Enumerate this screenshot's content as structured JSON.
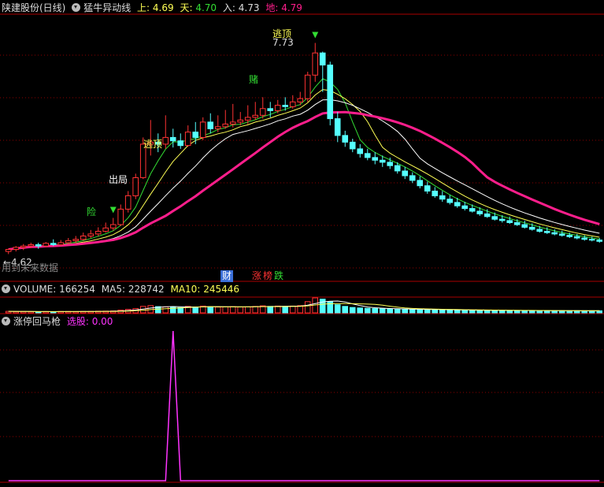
{
  "header": {
    "stock_title": "陕建股份(日线)",
    "indicator_name": "猛牛异动线",
    "shang_label": "上:",
    "shang_value": "4.69",
    "tian_label": "天:",
    "tian_value": "4.70",
    "ru_label": "入:",
    "ru_value": "4.73",
    "di_label": "地:",
    "di_value": "4.79"
  },
  "price_panel": {
    "low_marker": "←4.62",
    "watermark": "用到未来数据",
    "peak_label": "逃顶",
    "peak_value": "7.73",
    "signals": [
      {
        "text": "险",
        "color": "#33dd33"
      },
      {
        "text": "出局",
        "color": "#ffffff"
      },
      {
        "text": "逃顶",
        "color": "#ffff55"
      },
      {
        "text": "赌",
        "color": "#33dd33"
      }
    ],
    "bottom_tags": [
      {
        "text": "财",
        "bg": "#3a6fd8",
        "color": "#ffffff"
      },
      {
        "text": "涨",
        "bg": "#000000",
        "color": "#ff3333"
      },
      {
        "text": "榜",
        "bg": "#000000",
        "color": "#ff3333"
      },
      {
        "text": "跌",
        "bg": "#000000",
        "color": "#33dd33"
      }
    ]
  },
  "volume_header": {
    "volume_label": "VOLUME:",
    "volume_value": "166254",
    "ma5_label": "MA5:",
    "ma5_value": "228742",
    "ma10_label": "MA10:",
    "ma10_value": "245446"
  },
  "indicator_header": {
    "name": "涨停回马枪",
    "pick_label": "选股:",
    "pick_value": "0.00"
  },
  "colors": {
    "up": "#ff3333",
    "down": "#55ffff",
    "ma_short": "#ffffff",
    "ma_mid": "#ffff55",
    "ma_long": "#33dd33",
    "ma_trend": "#ff1e8c",
    "indicator_line": "#ff33ff",
    "grid": "#8b0000"
  },
  "chart_data": {
    "type": "candlestick",
    "price_range": [
      4.55,
      7.9
    ],
    "candles": [
      [
        4.62,
        4.65,
        4.58,
        4.66
      ],
      [
        4.65,
        4.68,
        4.62,
        4.7
      ],
      [
        4.68,
        4.7,
        4.64,
        4.73
      ],
      [
        4.7,
        4.72,
        4.67,
        4.75
      ],
      [
        4.72,
        4.7,
        4.66,
        4.75
      ],
      [
        4.7,
        4.74,
        4.68,
        4.76
      ],
      [
        4.74,
        4.72,
        4.7,
        4.8
      ],
      [
        4.72,
        4.75,
        4.7,
        4.79
      ],
      [
        4.75,
        4.78,
        4.73,
        4.82
      ],
      [
        4.78,
        4.8,
        4.75,
        4.85
      ],
      [
        4.8,
        4.85,
        4.78,
        4.9
      ],
      [
        4.85,
        4.88,
        4.82,
        4.94
      ],
      [
        4.88,
        4.92,
        4.85,
        4.98
      ],
      [
        4.92,
        4.97,
        4.9,
        5.05
      ],
      [
        4.97,
        5.02,
        4.93,
        5.12
      ],
      [
        5.02,
        5.25,
        5.0,
        5.32
      ],
      [
        5.25,
        5.45,
        5.2,
        5.52
      ],
      [
        5.45,
        5.72,
        5.4,
        5.78
      ],
      [
        5.72,
        6.22,
        5.7,
        6.32
      ],
      [
        6.22,
        6.25,
        6.05,
        6.58
      ],
      [
        6.25,
        6.22,
        6.1,
        6.38
      ],
      [
        6.22,
        6.32,
        6.15,
        6.65
      ],
      [
        6.32,
        6.27,
        6.17,
        6.45
      ],
      [
        6.27,
        6.2,
        6.15,
        6.38
      ],
      [
        6.2,
        6.4,
        6.18,
        6.5
      ],
      [
        6.4,
        6.32,
        6.22,
        6.55
      ],
      [
        6.32,
        6.55,
        6.28,
        6.62
      ],
      [
        6.55,
        6.45,
        6.38,
        6.68
      ],
      [
        6.45,
        6.48,
        6.4,
        6.65
      ],
      [
        6.48,
        6.52,
        6.45,
        6.73
      ],
      [
        6.52,
        6.55,
        6.47,
        6.82
      ],
      [
        6.55,
        6.58,
        6.5,
        6.7
      ],
      [
        6.58,
        6.62,
        6.52,
        6.8
      ],
      [
        6.62,
        6.65,
        6.58,
        6.85
      ],
      [
        6.65,
        6.75,
        6.6,
        6.92
      ],
      [
        6.75,
        6.72,
        6.62,
        6.85
      ],
      [
        6.72,
        6.8,
        6.68,
        6.88
      ],
      [
        6.8,
        6.78,
        6.72,
        6.92
      ],
      [
        6.78,
        6.85,
        6.75,
        6.95
      ],
      [
        6.85,
        6.9,
        6.8,
        7.0
      ],
      [
        6.9,
        7.25,
        6.85,
        7.3
      ],
      [
        7.25,
        7.58,
        7.15,
        7.73
      ],
      [
        7.58,
        7.4,
        7.0,
        7.6
      ],
      [
        7.4,
        6.6,
        6.5,
        7.45
      ],
      [
        6.6,
        6.35,
        6.25,
        6.7
      ],
      [
        6.35,
        6.25,
        6.18,
        6.42
      ],
      [
        6.25,
        6.15,
        6.1,
        6.3
      ],
      [
        6.15,
        6.08,
        6.02,
        6.22
      ],
      [
        6.08,
        6.02,
        5.98,
        6.15
      ],
      [
        6.02,
        5.98,
        5.92,
        6.1
      ],
      [
        5.98,
        5.95,
        5.88,
        6.05
      ],
      [
        5.95,
        5.9,
        5.85,
        6.02
      ],
      [
        5.9,
        5.82,
        5.78,
        5.95
      ],
      [
        5.82,
        5.75,
        5.7,
        5.88
      ],
      [
        5.75,
        5.68,
        5.64,
        5.8
      ],
      [
        5.68,
        5.6,
        5.56,
        5.74
      ],
      [
        5.6,
        5.52,
        5.48,
        5.66
      ],
      [
        5.52,
        5.45,
        5.42,
        5.58
      ],
      [
        5.45,
        5.4,
        5.36,
        5.52
      ],
      [
        5.4,
        5.35,
        5.32,
        5.46
      ],
      [
        5.35,
        5.3,
        5.27,
        5.42
      ],
      [
        5.3,
        5.26,
        5.23,
        5.36
      ],
      [
        5.26,
        5.22,
        5.2,
        5.32
      ],
      [
        5.22,
        5.18,
        5.15,
        5.28
      ],
      [
        5.18,
        5.14,
        5.12,
        5.25
      ],
      [
        5.14,
        5.1,
        5.08,
        5.2
      ],
      [
        5.1,
        5.08,
        5.05,
        5.16
      ],
      [
        5.08,
        5.05,
        5.03,
        5.14
      ],
      [
        5.05,
        5.02,
        5.0,
        5.1
      ],
      [
        5.02,
        4.98,
        4.96,
        5.08
      ],
      [
        4.98,
        4.95,
        4.93,
        5.04
      ],
      [
        4.95,
        4.92,
        4.9,
        5.0
      ],
      [
        4.92,
        4.9,
        4.88,
        4.98
      ],
      [
        4.9,
        4.88,
        4.86,
        4.95
      ],
      [
        4.88,
        4.86,
        4.84,
        4.93
      ],
      [
        4.86,
        4.84,
        4.82,
        4.9
      ],
      [
        4.84,
        4.82,
        4.8,
        4.88
      ],
      [
        4.82,
        4.8,
        4.78,
        4.86
      ],
      [
        4.8,
        4.79,
        4.77,
        4.84
      ],
      [
        4.79,
        4.77,
        4.75,
        4.82
      ]
    ],
    "volume": [
      120,
      110,
      105,
      95,
      90,
      100,
      95,
      110,
      105,
      100,
      115,
      120,
      130,
      140,
      150,
      220,
      280,
      340,
      520,
      580,
      500,
      480,
      450,
      420,
      520,
      470,
      540,
      490,
      460,
      480,
      500,
      470,
      480,
      510,
      560,
      520,
      540,
      510,
      540,
      580,
      900,
      1200,
      1100,
      900,
      650,
      520,
      430,
      390,
      360,
      340,
      330,
      310,
      300,
      290,
      280,
      270,
      260,
      250,
      240,
      230,
      220,
      215,
      210,
      205,
      200,
      195,
      190,
      188,
      185,
      180,
      178,
      175,
      172,
      170,
      168,
      166,
      165,
      165,
      166,
      166
    ],
    "indicator": [
      0,
      0,
      0,
      0,
      0,
      0,
      0,
      0,
      0,
      0,
      0,
      0,
      0,
      0,
      0,
      0,
      0,
      0,
      0,
      0,
      0,
      0,
      1,
      0,
      0,
      0,
      0,
      0,
      0,
      0,
      0,
      0,
      0,
      0,
      0,
      0,
      0,
      0,
      0,
      0,
      0,
      0,
      0,
      0,
      0,
      0,
      0,
      0,
      0,
      0,
      0,
      0,
      0,
      0,
      0,
      0,
      0,
      0,
      0,
      0,
      0,
      0,
      0,
      0,
      0,
      0,
      0,
      0,
      0,
      0,
      0,
      0,
      0,
      0,
      0,
      0,
      0,
      0,
      0,
      0
    ]
  }
}
